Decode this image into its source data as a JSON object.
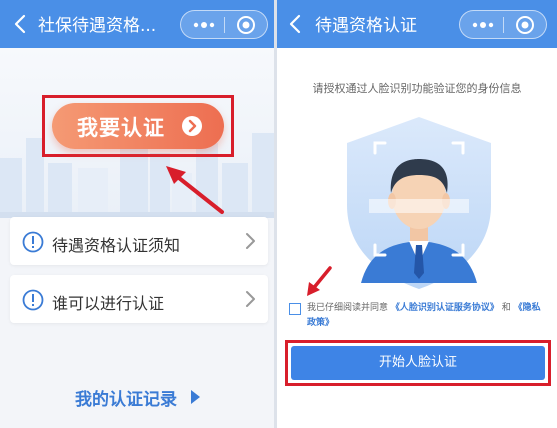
{
  "left": {
    "header": {
      "title": "社保待遇资格..."
    },
    "hero": {
      "cta_label": "我要认证"
    },
    "menu": [
      {
        "label": "待遇资格认证须知"
      },
      {
        "label": "谁可以进行认证"
      }
    ],
    "records_link": "我的认证记录"
  },
  "right": {
    "header": {
      "title": "待遇资格认证"
    },
    "hint": "请授权通过人脸识别功能验证您的身份信息",
    "agreement": {
      "prefix": "我已仔细阅读并同意",
      "link1": "《人脸识别认证服务协议》",
      "conj": "和",
      "link2": "《隐私政策》"
    },
    "start_button": "开始人脸认证"
  },
  "colors": {
    "header_blue": "#4a8fe7",
    "cta_orange": "#ed6e51",
    "link_blue": "#3a7bd5",
    "annotation_red": "#d81e2b"
  },
  "icons": [
    "back-arrow-icon",
    "more-dots-icon",
    "target-icon",
    "chevron-circle-right-icon",
    "info-circle-icon",
    "chevron-right-icon",
    "face-shield-icon"
  ]
}
